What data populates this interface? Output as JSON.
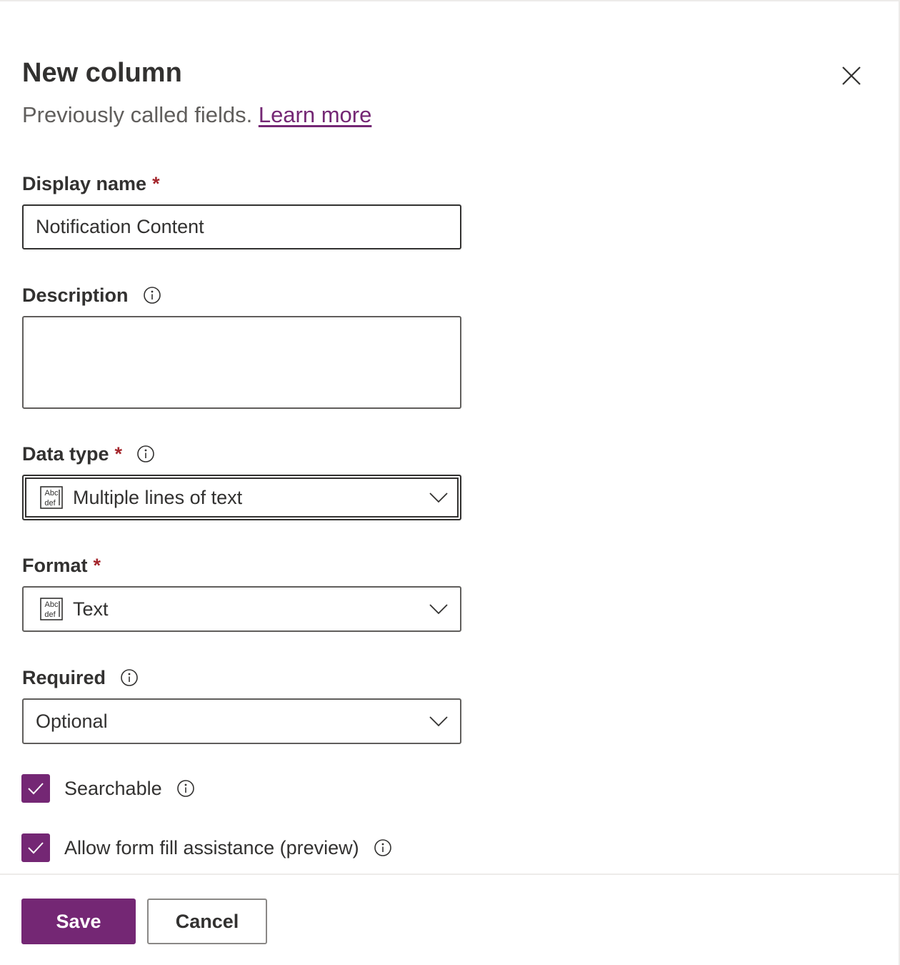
{
  "header": {
    "title": "New column",
    "subtitle": "Previously called fields.",
    "learn_more": "Learn more"
  },
  "fields": {
    "display_name": {
      "label": "Display name",
      "required_marker": "*",
      "value": "Notification Content"
    },
    "description": {
      "label": "Description",
      "value": ""
    },
    "data_type": {
      "label": "Data type",
      "required_marker": "*",
      "value": "Multiple lines of text",
      "icon": "abc-def-text-icon"
    },
    "format": {
      "label": "Format",
      "required_marker": "*",
      "value": "Text",
      "icon": "abc-def-text-icon"
    },
    "required": {
      "label": "Required",
      "value": "Optional"
    }
  },
  "checkboxes": {
    "searchable": {
      "label": "Searchable",
      "checked": true
    },
    "form_fill": {
      "label": "Allow form fill assistance (preview)",
      "checked": true
    }
  },
  "footer": {
    "save_label": "Save",
    "cancel_label": "Cancel"
  },
  "colors": {
    "accent": "#742774",
    "required": "#a4262c",
    "text": "#323130",
    "muted": "#605e5c"
  }
}
